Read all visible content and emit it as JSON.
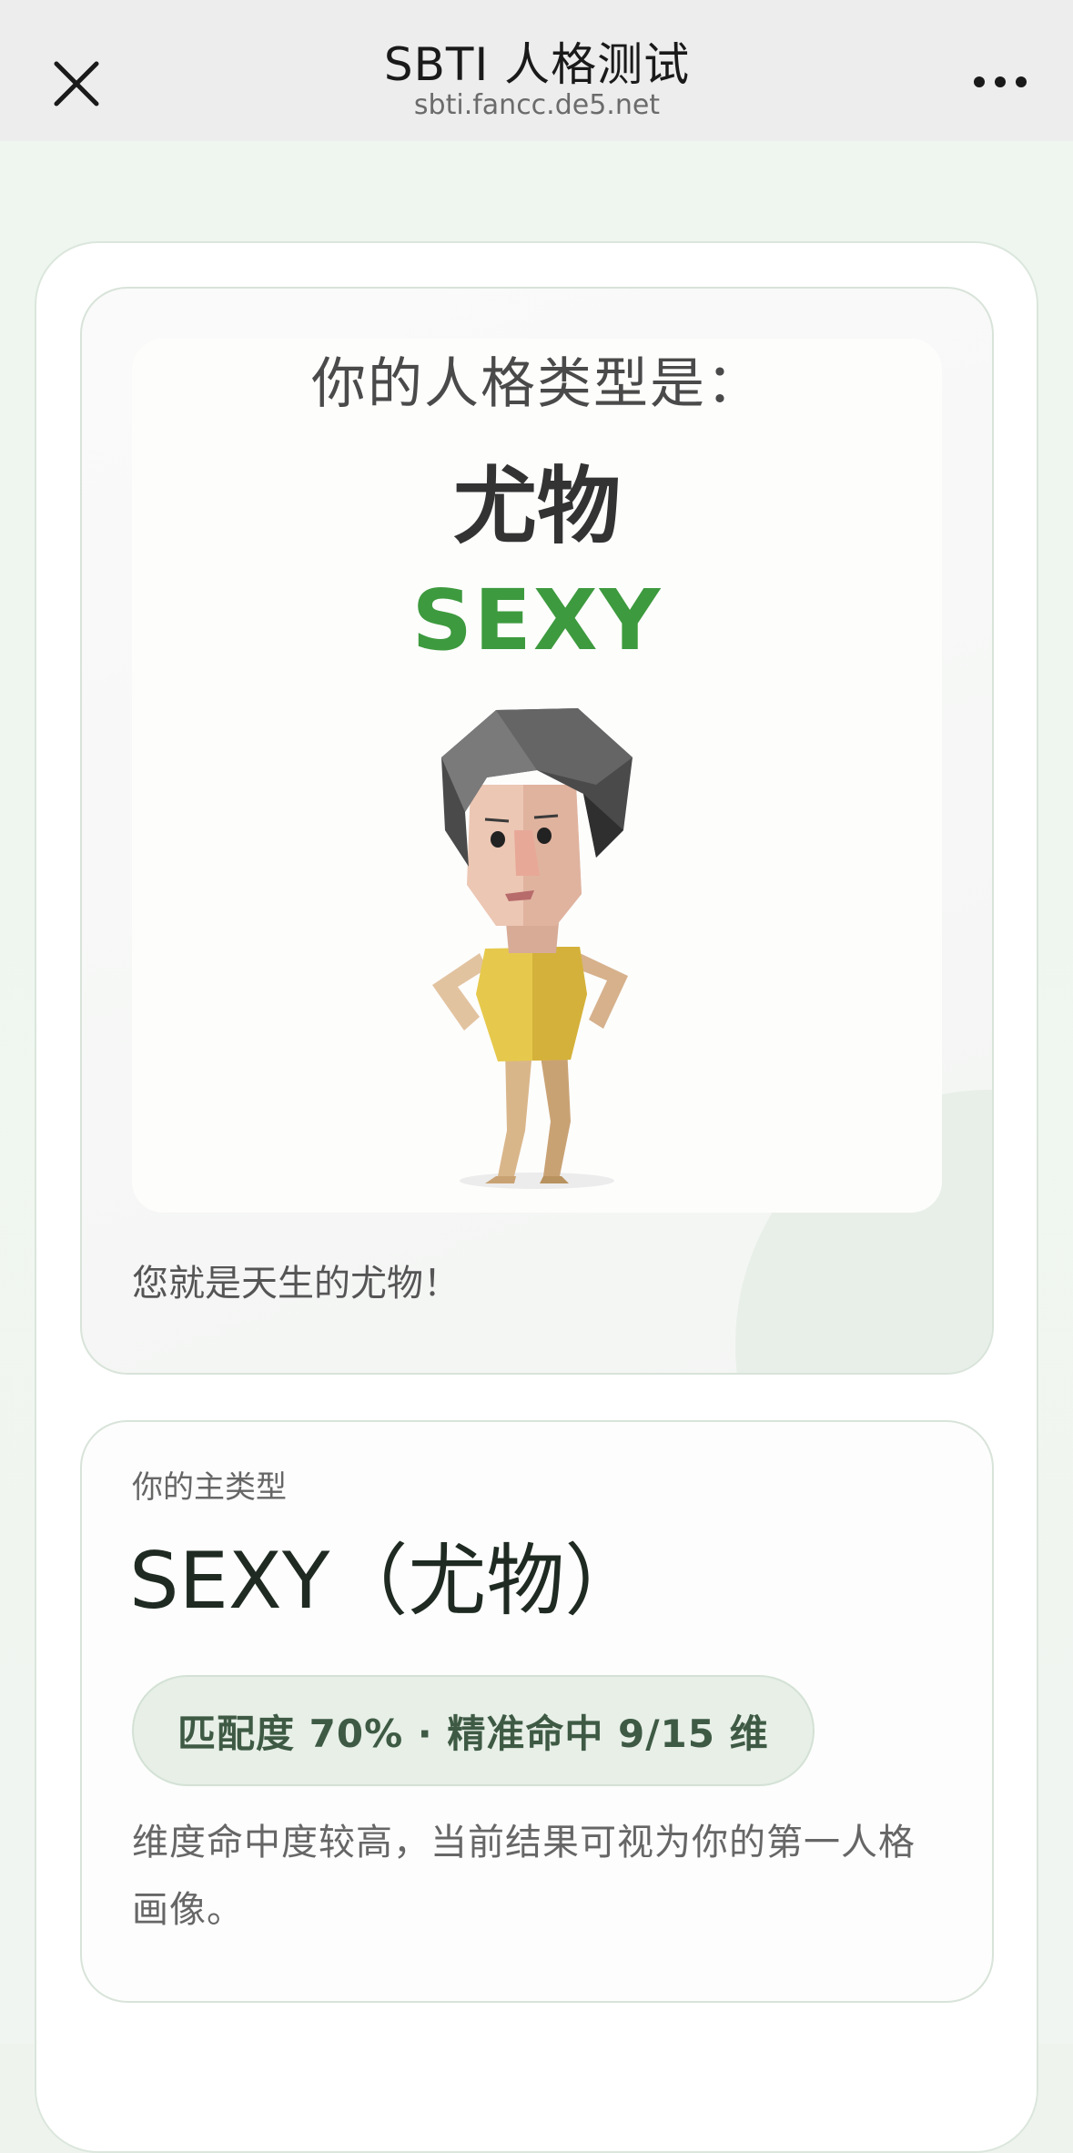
{
  "header": {
    "title": "SBTI 人格测试",
    "url": "sbti.fancc.de5.net"
  },
  "result": {
    "heading": "你的人格类型是：",
    "type_cn": "尤物",
    "type_en": "SEXY",
    "tagline": "您就是天生的尤物！",
    "accent_color": "#3d9a3e"
  },
  "main_type": {
    "label": "你的主类型",
    "value": "SEXY（尤物）",
    "match": "匹配度 70% · 精准命中 9/15 维",
    "description": "维度命中度较高，当前结果可视为你的第一人格画像。"
  },
  "icons": {
    "close": "close-icon",
    "more": "more-icon"
  }
}
